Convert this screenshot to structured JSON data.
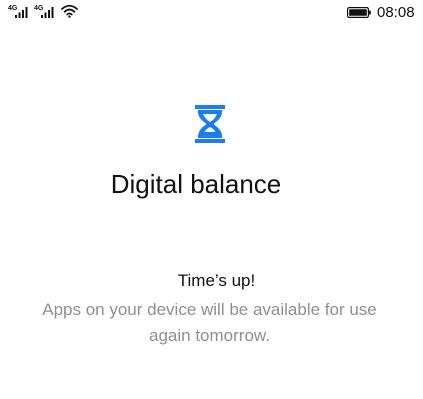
{
  "status_bar": {
    "sim1_network": "4G",
    "sim2_network": "4G",
    "time": "08:08",
    "icons": [
      "signal-icon",
      "signal-icon",
      "wifi-icon",
      "battery-icon"
    ]
  },
  "screen": {
    "icon": "hourglass-icon",
    "title": "Digital balance",
    "message_heading": "Time’s up!",
    "message_line_1": "Apps on your device will be available for use",
    "message_line_2": "again tomorrow."
  },
  "colors": {
    "accent": "#1a7cf7",
    "text_primary": "#111111",
    "text_secondary": "#8f8f8f",
    "background": "#ffffff"
  }
}
